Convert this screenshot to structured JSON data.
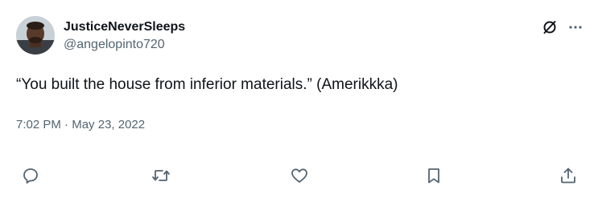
{
  "user": {
    "display_name": "JusticeNeverSleeps",
    "handle": "@angelopinto720",
    "avatar_icon": "profile-photo"
  },
  "header_actions": {
    "grok_icon": "slashed-circle-icon",
    "more_icon": "ellipsis-icon"
  },
  "tweet": {
    "text": "“You built the house from inferior materials.” (Amerikkka)",
    "time": "7:02 PM",
    "separator": " · ",
    "date": "May 23, 2022"
  },
  "actions": [
    {
      "name": "reply",
      "icon": "reply-icon"
    },
    {
      "name": "retweet",
      "icon": "retweet-icon"
    },
    {
      "name": "like",
      "icon": "heart-icon"
    },
    {
      "name": "bookmark",
      "icon": "bookmark-icon"
    },
    {
      "name": "share",
      "icon": "share-icon"
    }
  ],
  "colors": {
    "text_primary": "#0f1419",
    "text_secondary": "#536471",
    "icon": "#536471",
    "background": "#ffffff"
  }
}
